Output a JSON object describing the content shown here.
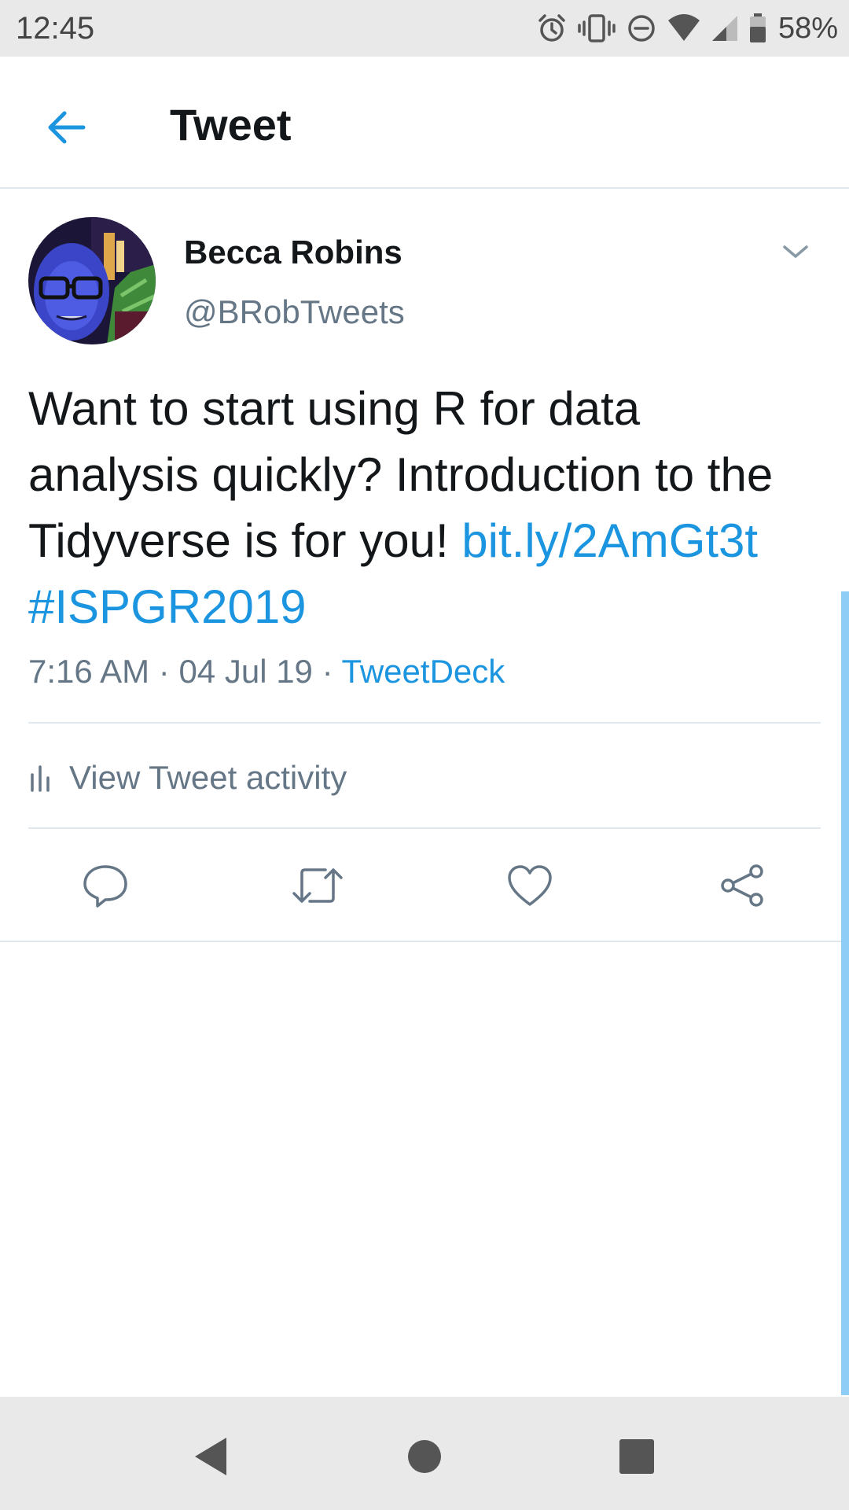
{
  "status_bar": {
    "time": "12:45",
    "battery_percent": "58%",
    "icons": [
      "alarm-icon",
      "vibrate-icon",
      "do-not-disturb-icon",
      "wifi-icon",
      "cell-signal-icon",
      "battery-icon"
    ]
  },
  "app_bar": {
    "title": "Tweet",
    "back_icon": "back-arrow-icon"
  },
  "tweet": {
    "author_name": "Becca Robins",
    "author_handle": "@BRobTweets",
    "text": "Want to start using R for data analysis quickly? Introduction to the Tidyverse is for you!",
    "link": "bit.ly/2AmGt3t",
    "hashtag": "#ISPGR2019",
    "time": "7:16 AM",
    "date": "04 Jul 19",
    "source": "TweetDeck",
    "separator": "·"
  },
  "activity": {
    "label": "View Tweet activity"
  },
  "actions": [
    "reply-icon",
    "retweet-icon",
    "like-icon",
    "share-icon"
  ],
  "colors": {
    "accent": "#1b95e0",
    "secondary_text": "#657786",
    "primary_text": "#14171a",
    "divider": "#e1e8ed",
    "scrollbar": "#8ecdf5",
    "system_bar": "#e9e9e9"
  }
}
